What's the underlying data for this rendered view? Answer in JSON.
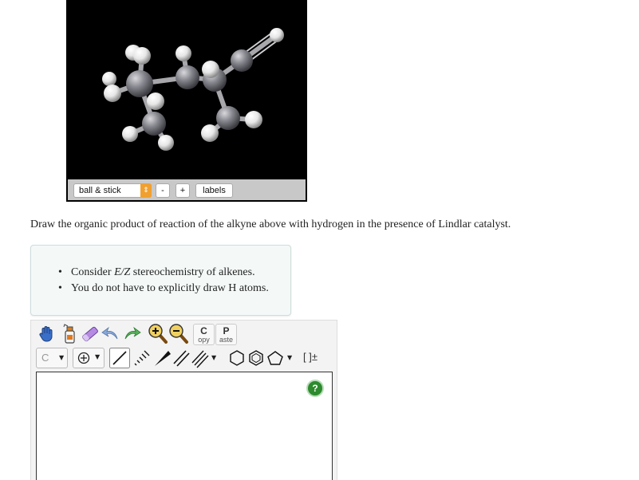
{
  "viewer": {
    "style_select": "ball & stick",
    "minus_label": "-",
    "plus_label": "+",
    "labels_label": "labels"
  },
  "question": "Draw the organic product of reaction of the alkyne above with hydrogen in the presence of Lindlar catalyst.",
  "hints": {
    "item1_pre": "Consider ",
    "item1_ez": "E/Z",
    "item1_post": " stereochemistry of alkenes.",
    "item2": "You do not have to explicitly draw H atoms."
  },
  "toolbar": {
    "copy_big": "C",
    "copy_small": "opy",
    "paste_big": "P",
    "paste_small": "aste",
    "atom_value": "C",
    "bracket_label": "[ ]±",
    "help_label": "?"
  }
}
